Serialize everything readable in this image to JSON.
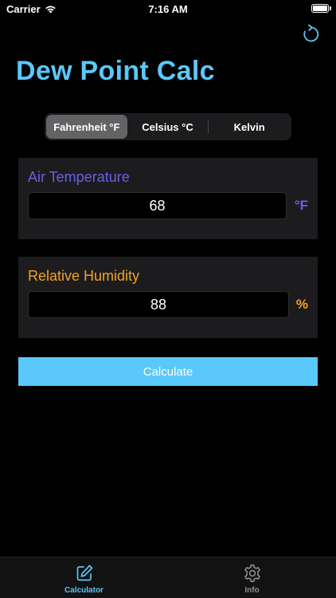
{
  "status_bar": {
    "carrier": "Carrier",
    "time": "7:16 AM"
  },
  "app": {
    "title": "Dew Point Calc",
    "accent_color": "#5ac8fa"
  },
  "units": {
    "options": [
      "Fahrenheit °F",
      "Celsius °C",
      "Kelvin"
    ],
    "selected": "Fahrenheit °F"
  },
  "air_temperature": {
    "label": "Air Temperature",
    "value": "68",
    "unit": "°F",
    "color": "#6a5fe8"
  },
  "relative_humidity": {
    "label": "Relative Humidity",
    "value": "88",
    "unit": "%",
    "color": "#f4a123"
  },
  "actions": {
    "calculate_label": "Calculate",
    "refresh_icon": "refresh-icon"
  },
  "tab_bar": {
    "tabs": [
      {
        "label": "Calculator",
        "icon": "pencil-square-icon",
        "active": true
      },
      {
        "label": "Info",
        "icon": "gear-icon",
        "active": false
      }
    ]
  }
}
